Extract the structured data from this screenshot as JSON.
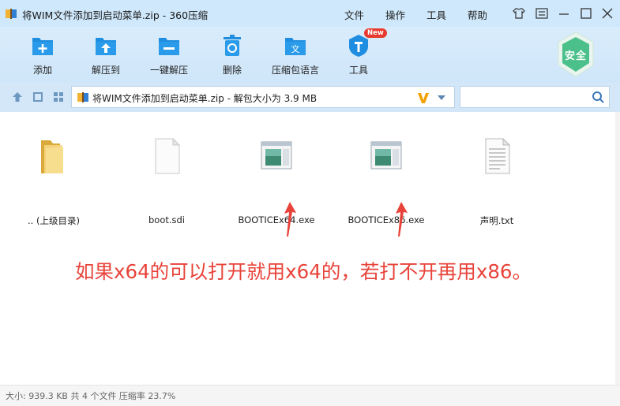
{
  "window": {
    "title": "将WIM文件添加到启动菜单.zip - 360压缩"
  },
  "menu": {
    "file": "文件",
    "operation": "操作",
    "tools": "工具",
    "help": "帮助"
  },
  "toolbar": {
    "add": "添加",
    "extract_to": "解压到",
    "one_click_extract": "一键解压",
    "delete": "删除",
    "language": "压缩包语言",
    "tools": "工具",
    "new_badge": "New",
    "safe": "安全"
  },
  "address": {
    "path": "将WIM文件添加到启动菜单.zip - 解包大小为 3.9 MB"
  },
  "search": {
    "value": "",
    "placeholder": ""
  },
  "files": [
    {
      "name": ".. (上级目录)",
      "type": "folder"
    },
    {
      "name": "boot.sdi",
      "type": "blank-file"
    },
    {
      "name": "BOOTICEx64.exe",
      "type": "exe"
    },
    {
      "name": "BOOTICEx86.exe",
      "type": "exe"
    },
    {
      "name": "声明.txt",
      "type": "text-file"
    }
  ],
  "annotation": {
    "text": "如果x64的可以打开就用x64的，若打不开再用x86。"
  },
  "status": {
    "text": "大小: 939.3 KB 共 4 个文件 压缩率 23.7%"
  },
  "colors": {
    "titlebar": "#cfe8fb",
    "toolbar": "#d4e9fa",
    "accent_blue": "#1f8ee0",
    "annotation_red": "#e8433a",
    "safe_green": "#4cc08a"
  }
}
